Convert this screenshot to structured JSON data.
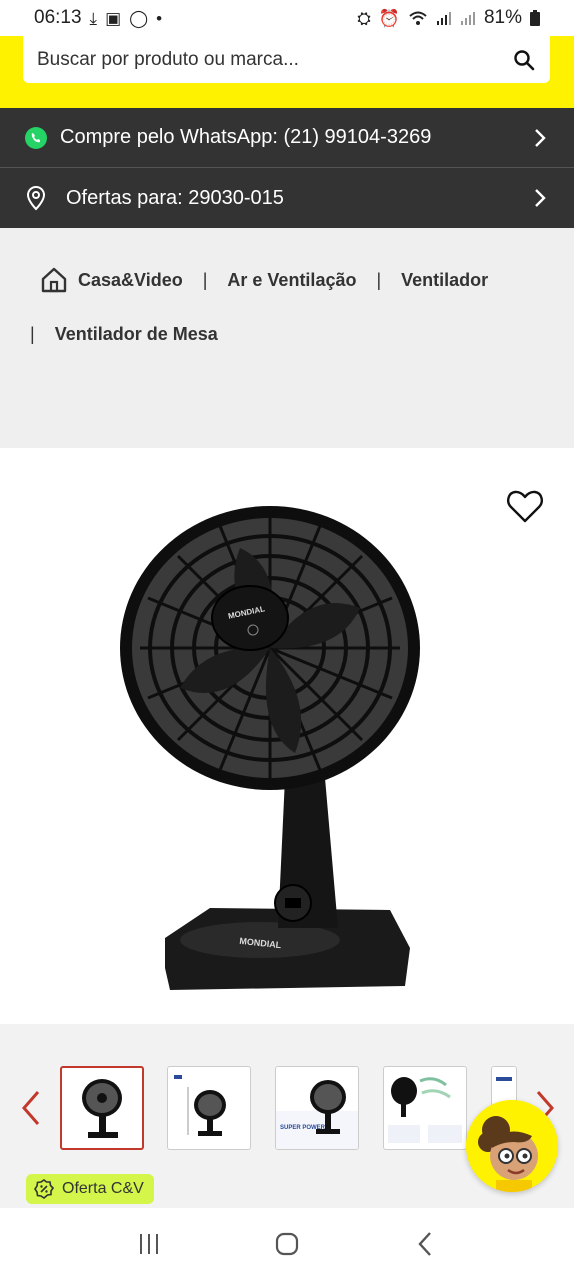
{
  "status_bar": {
    "time": "06:13",
    "left_icons": [
      "download-icon",
      "gallery-icon",
      "whatsapp-icon",
      "dot-icon"
    ],
    "right_icons": [
      "vpn-icon",
      "alarm-icon",
      "wifi-icon",
      "signal-icon",
      "signal-icon-2"
    ],
    "battery": "81%"
  },
  "search": {
    "placeholder": "Buscar por produto ou marca..."
  },
  "whatsapp_row": {
    "text": "Compre pelo WhatsApp: (21) 99104-3269"
  },
  "offers_row": {
    "text": "Ofertas para: 29030-015"
  },
  "breadcrumb": {
    "items": [
      "Casa&Video",
      "Ar e Ventilação",
      "Ventilador",
      "Ventilador de Mesa"
    ],
    "separator": "|"
  },
  "product": {
    "brand_on_fan": "MONDIAL",
    "favorite_icon": "heart-outline-icon"
  },
  "thumbnails": {
    "count_visible": 5,
    "active_index": 0,
    "labels": [
      "",
      "",
      "SUPER POWER",
      "",
      ""
    ]
  },
  "badge": {
    "label": "Oferta C&V"
  },
  "colors": {
    "brand_yellow": "#fff200",
    "dark_bar": "#333333",
    "accent_red": "#c0392b",
    "badge_green": "#d4f54a"
  }
}
